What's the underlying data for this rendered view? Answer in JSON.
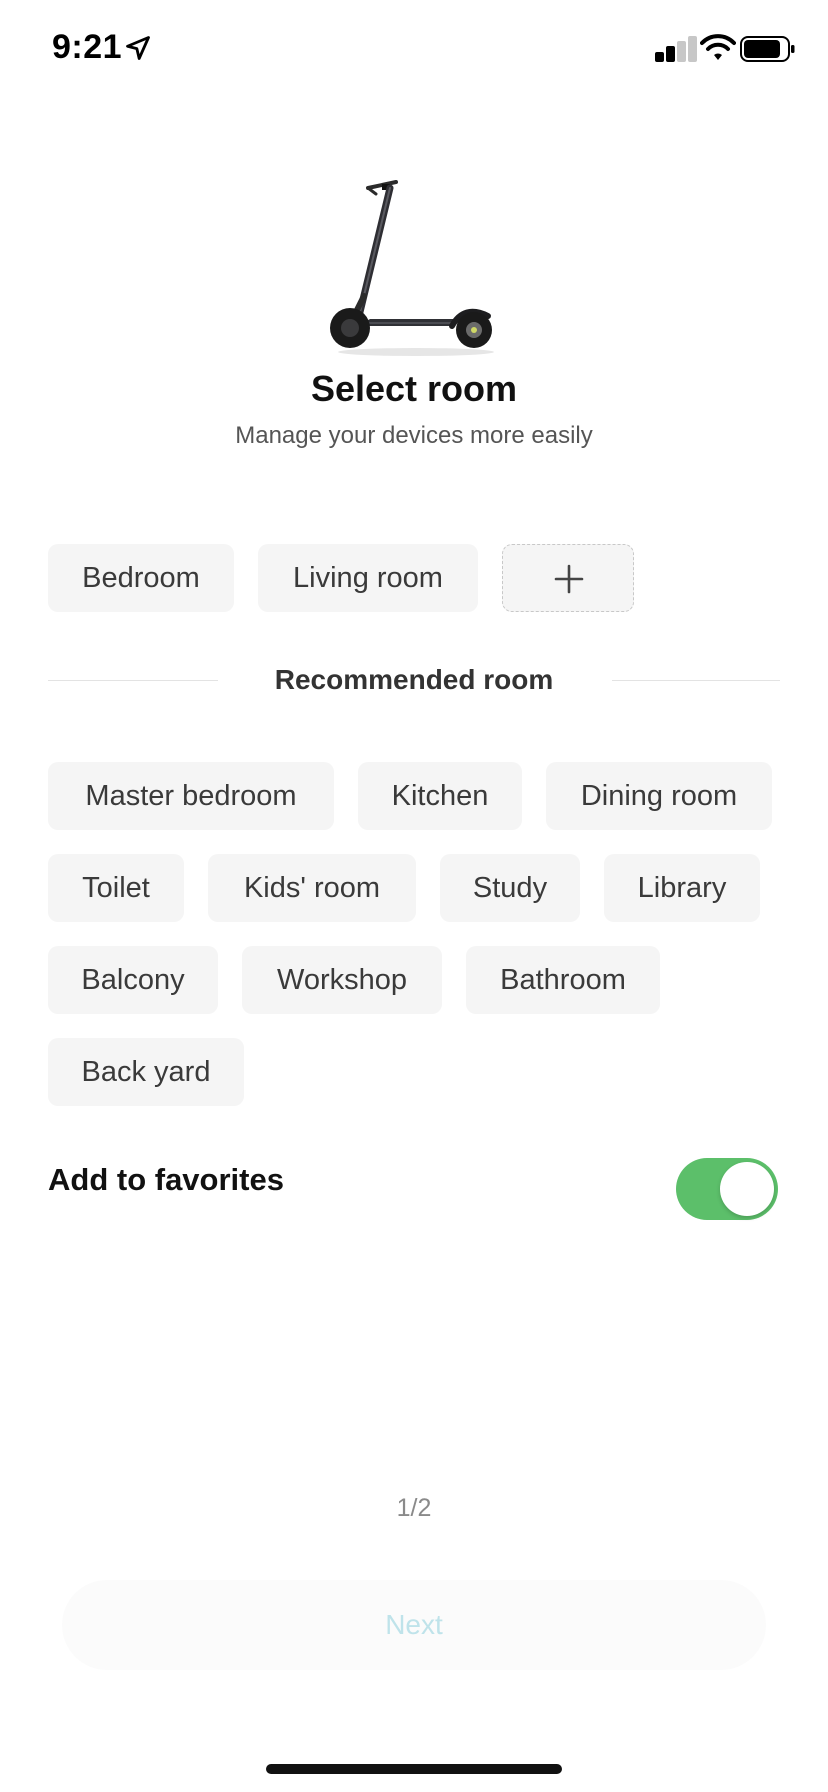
{
  "status_bar": {
    "time": "9:21",
    "icons": [
      "location-arrow-icon",
      "signal-icon",
      "wifi-icon",
      "battery-icon"
    ]
  },
  "hero": {
    "image": "scooter-image",
    "title": "Select room",
    "subtitle": "Manage your devices more easily"
  },
  "my_rooms": {
    "items": [
      "Bedroom",
      "Living room"
    ],
    "add_icon": "plus-icon"
  },
  "recommended": {
    "title": "Recommended room",
    "items": [
      "Master bedroom",
      "Kitchen",
      "Dining room",
      "Toilet",
      "Kids' room",
      "Study",
      "Library",
      "Balcony",
      "Workshop",
      "Bathroom",
      "Back yard"
    ]
  },
  "favorites": {
    "label": "Add to favorites",
    "enabled": true,
    "toggle_color": "#5cbf6a"
  },
  "pager": {
    "text": "1/2"
  },
  "footer": {
    "next_label": "Next",
    "next_text_color": "#bfe3ea"
  }
}
